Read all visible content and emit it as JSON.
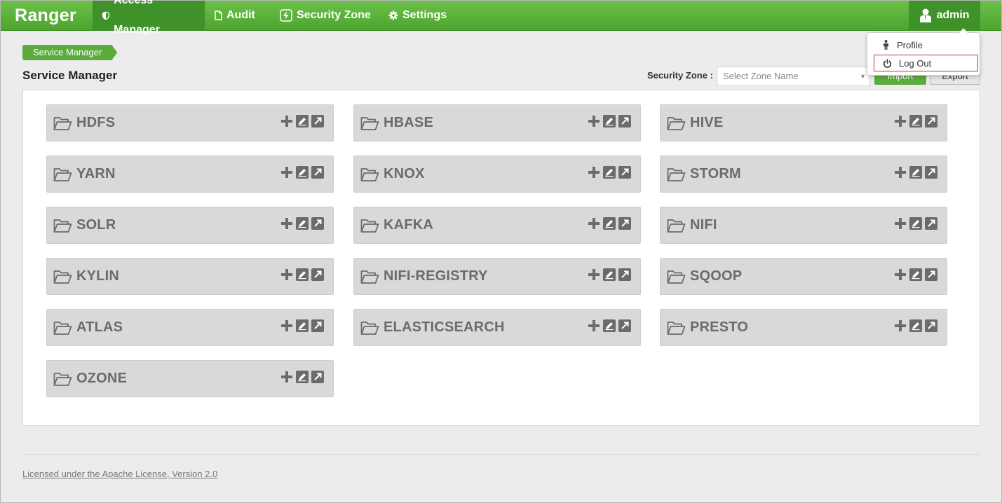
{
  "navbar": {
    "brand": "Ranger",
    "items": [
      {
        "label": "Access Manager",
        "icon": "shield-icon",
        "active": true
      },
      {
        "label": "Audit",
        "icon": "file-icon",
        "active": false
      },
      {
        "label": "Security Zone",
        "icon": "lightning-icon",
        "active": false
      },
      {
        "label": "Settings",
        "icon": "gear-icon",
        "active": false
      }
    ],
    "user": {
      "label": "admin",
      "icon": "user-icon"
    }
  },
  "dropdown": {
    "items": [
      {
        "label": "Profile",
        "icon": "person-icon"
      },
      {
        "label": "Log Out",
        "icon": "power-icon"
      }
    ]
  },
  "breadcrumb": "Service Manager",
  "page_title": "Service Manager",
  "security_zone": {
    "label": "Security Zone :",
    "placeholder": "Select Zone Name"
  },
  "buttons": {
    "import": "Import",
    "export": "Export"
  },
  "services": [
    "HDFS",
    "HBASE",
    "HIVE",
    "YARN",
    "KNOX",
    "STORM",
    "SOLR",
    "KAFKA",
    "NIFI",
    "KYLIN",
    "NIFI-REGISTRY",
    "SQOOP",
    "ATLAS",
    "ELASTICSEARCH",
    "PRESTO",
    "OZONE"
  ],
  "footer": {
    "license": "Licensed under the Apache License, Version 2.0"
  },
  "colors": {
    "brand_green": "#5cac3d",
    "nav_active": "#3f922a",
    "service_box": "#d9d9d9"
  }
}
